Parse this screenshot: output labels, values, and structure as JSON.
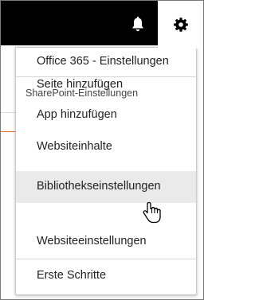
{
  "header": {
    "notification_icon": "bell-icon",
    "settings_icon": "gear-icon"
  },
  "menu": {
    "office_settings": "Office 365 - Einstellungen",
    "sharepoint_section": "SharePoint-Einstellungen",
    "items": [
      "Seite hinzufügen",
      "App hinzufügen",
      "Websiteinhalte",
      "Bibliothekseinstellungen",
      "Websiteeinstellungen"
    ],
    "hovered_item": "Bibliothekseinstellungen",
    "getting_started": "Erste Schritte"
  },
  "cursor": "hand-pointer-icon",
  "colors": {
    "topbar": "#000000",
    "hover": "#eaeaea",
    "accent": "#e86a32"
  }
}
